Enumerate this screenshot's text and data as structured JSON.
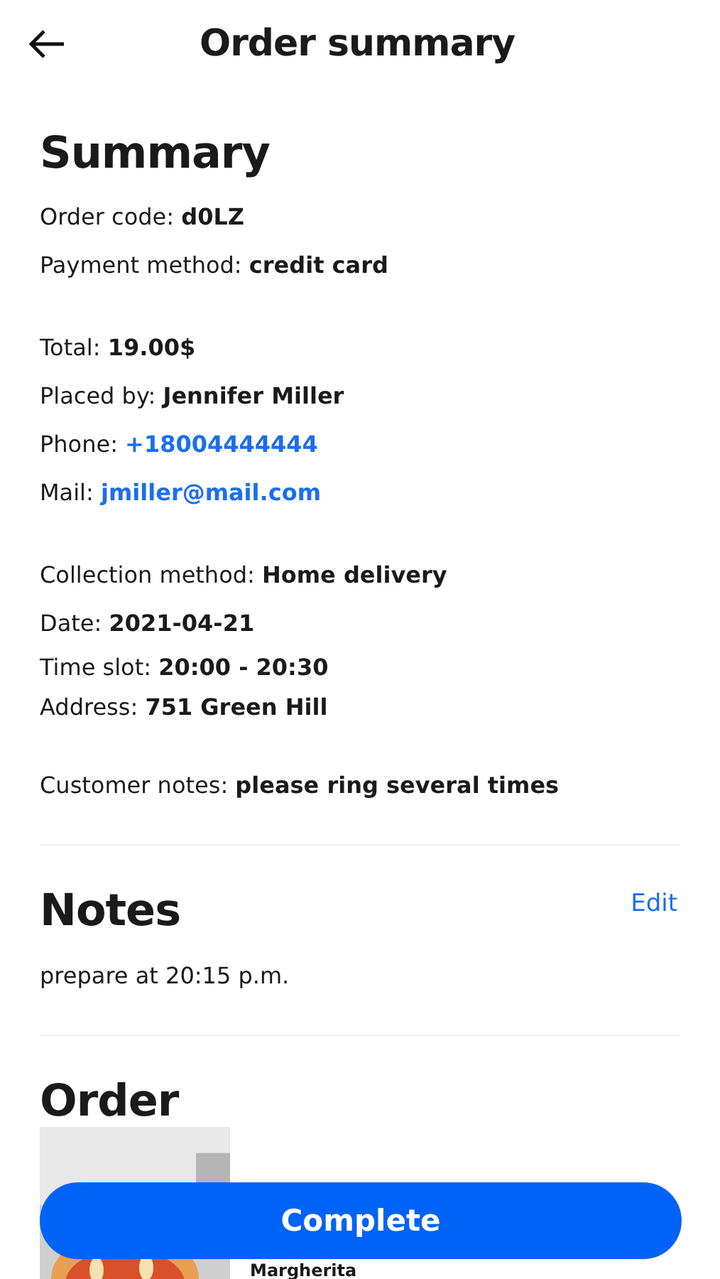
{
  "header": {
    "title": "Order summary"
  },
  "summary": {
    "heading": "Summary",
    "groups": [
      [
        {
          "label": "Order code:",
          "value": "d0LZ",
          "kind": "text"
        },
        {
          "label": "Payment method:",
          "value": "credit card",
          "kind": "text"
        }
      ],
      [
        {
          "label": "Total:",
          "value": "19.00$",
          "kind": "text"
        },
        {
          "label": "Placed by:",
          "value": "Jennifer Miller",
          "kind": "text"
        },
        {
          "label": "Phone:",
          "value": "+18004444444",
          "kind": "link"
        },
        {
          "label": "Mail:",
          "value": "jmiller@mail.com",
          "kind": "link"
        }
      ],
      [
        {
          "label": "Collection method:",
          "value": "Home delivery",
          "kind": "text"
        },
        {
          "label": "Date:",
          "value": "2021-04-21",
          "kind": "text"
        },
        {
          "label": "Time slot:",
          "value": "20:00 - 20:30",
          "kind": "text"
        },
        {
          "label": "Address:",
          "value": "751 Green Hill",
          "kind": "text"
        }
      ],
      [
        {
          "label": "Customer notes:",
          "value": "please ring several times",
          "kind": "text"
        }
      ]
    ]
  },
  "notes": {
    "heading": "Notes",
    "action": "Edit",
    "text": "prepare at 20:15 p.m."
  },
  "order": {
    "heading": "Order",
    "items": [
      {
        "name": "Margherita",
        "kind": "picture"
      }
    ]
  },
  "complete_button": "Complete"
}
